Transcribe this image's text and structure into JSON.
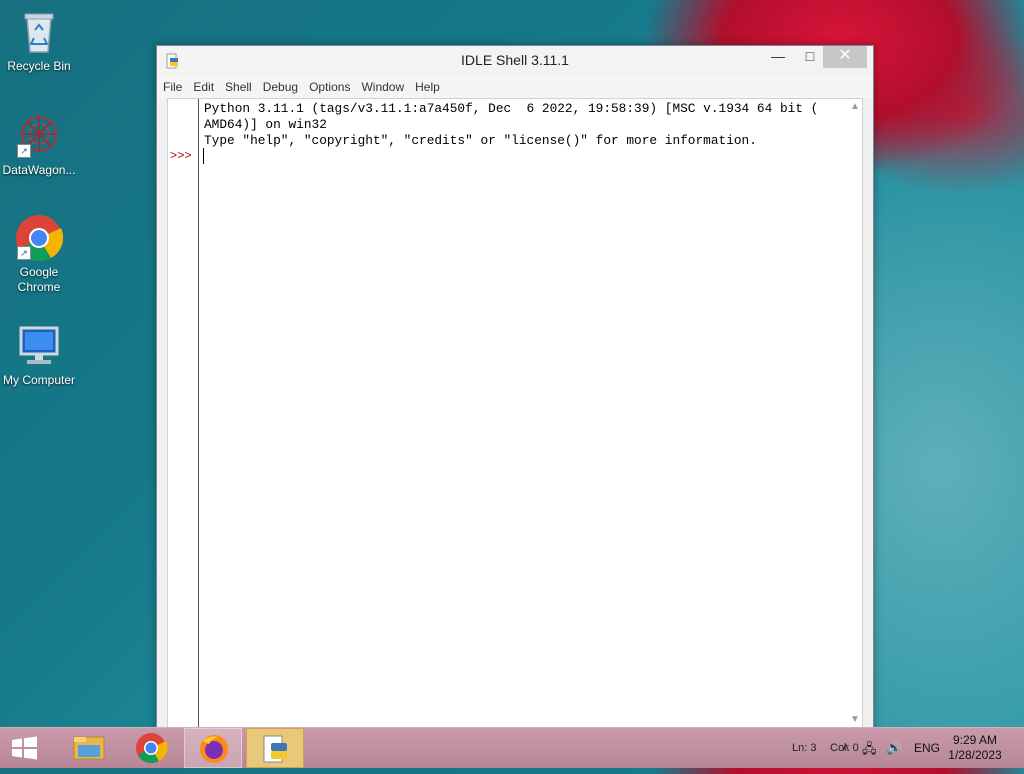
{
  "desktop": {
    "icons": [
      {
        "label": "Recycle Bin",
        "icon": "recycle-bin-icon"
      },
      {
        "label": "DataWagon...",
        "icon": "datawagon-icon"
      },
      {
        "label": "Google Chrome",
        "icon": "chrome-icon"
      },
      {
        "label": "My Computer",
        "icon": "computer-icon"
      }
    ]
  },
  "window": {
    "title": "IDLE Shell 3.11.1",
    "menu": [
      "File",
      "Edit",
      "Shell",
      "Debug",
      "Options",
      "Window",
      "Help"
    ],
    "shell_lines": [
      "Python 3.11.1 (tags/v3.11.1:a7a450f, Dec  6 2022, 19:58:39) [MSC v.1934 64 bit (",
      "AMD64)] on win32",
      "Type \"help\", \"copyright\", \"credits\" or \"license()\" for more information."
    ],
    "prompt": ">>>"
  },
  "taskbar": {
    "apps": [
      "file-explorer-icon",
      "chrome-icon",
      "firefox-icon",
      "python-idle-icon"
    ],
    "line": "Ln: 3",
    "col": "Col: 0",
    "language": "ENG",
    "time": "9:29 AM",
    "date": "1/28/2023"
  }
}
